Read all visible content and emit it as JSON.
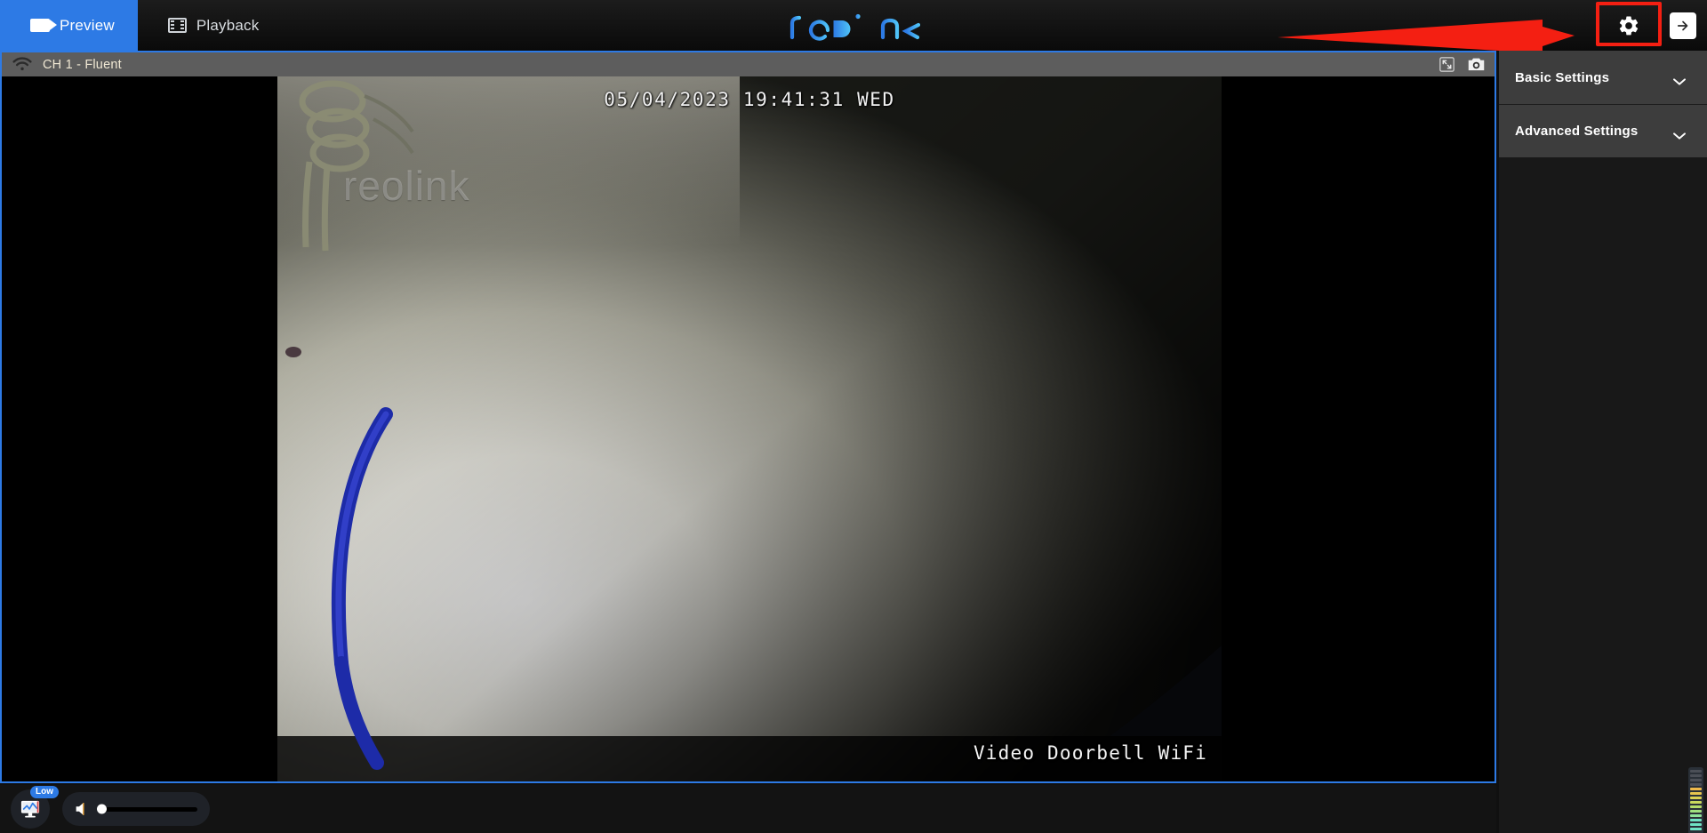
{
  "app": {
    "brand": "reolink",
    "brand_color": "#2d8cf5"
  },
  "topbar": {
    "tabs": [
      {
        "label": "Preview",
        "icon": "camera-icon",
        "active": true
      },
      {
        "label": "Playback",
        "icon": "film-icon",
        "active": false
      }
    ],
    "settings_icon": "gear-icon",
    "exit_icon": "exit-arrow-icon",
    "highlight_color": "#f41f12",
    "active_tab_color": "#2d7ae5"
  },
  "channel": {
    "label": "CH 1 - Fluent",
    "signal_icon": "wifi-icon",
    "fullscreen_icon": "fullscreen-icon",
    "snapshot_icon": "camera-snapshot-icon"
  },
  "video": {
    "osd_timestamp": "05/04/2023 19:41:31 WED",
    "osd_device_name": "Video Doorbell WiFi",
    "watermark": "reolink"
  },
  "bottombar": {
    "bandwidth_icon": "monitor-bandwidth-icon",
    "bandwidth_badge": "Low",
    "volume_icon": "speaker-icon",
    "volume_value": 0
  },
  "sidebar": {
    "items": [
      {
        "label": "Basic Settings",
        "chevron": "chevron-down-icon"
      },
      {
        "label": "Advanced Settings",
        "chevron": "chevron-down-icon"
      }
    ]
  }
}
